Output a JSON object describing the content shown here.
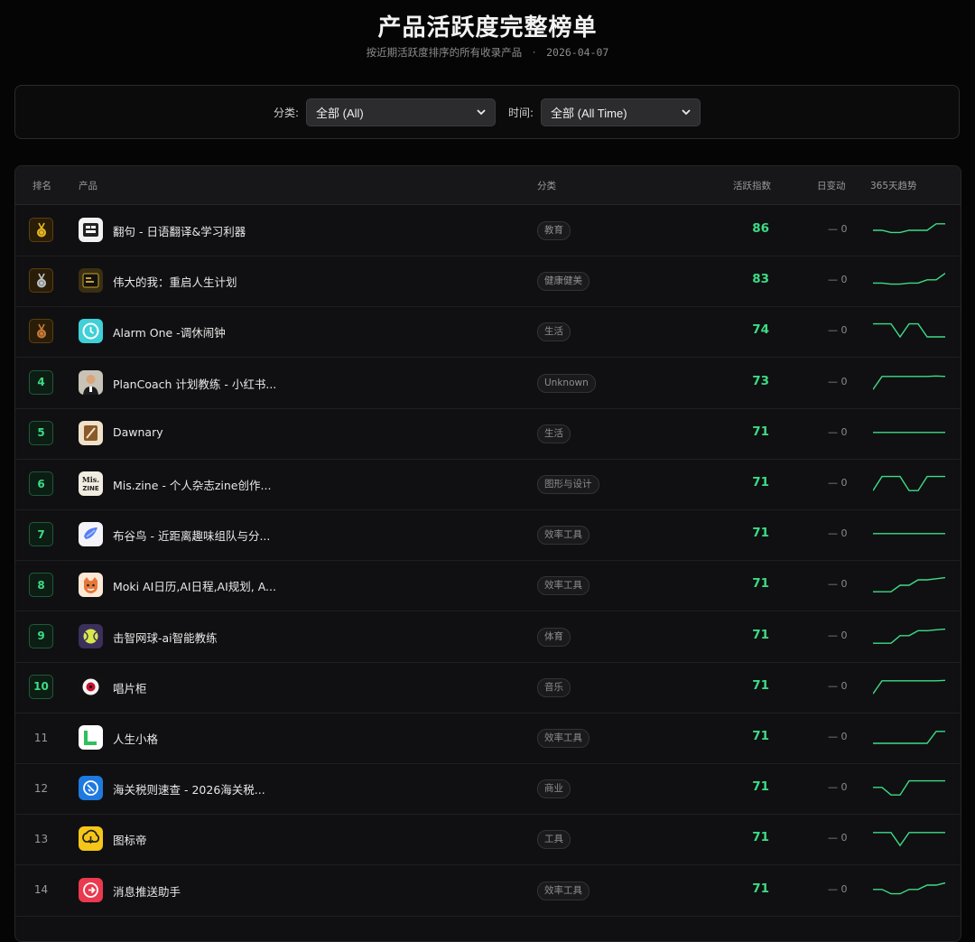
{
  "header": {
    "title": "产品活跃度完整榜单",
    "subtitle": "按近期活跃度排序的所有收录产品",
    "separator": "·",
    "date": "2026-04-07"
  },
  "filters": {
    "category_label": "分类:",
    "category_value": "全部 (All)",
    "time_label": "时间:",
    "time_value": "全部 (All Time)"
  },
  "table": {
    "columns": {
      "rank": "排名",
      "product": "产品",
      "category": "分类",
      "score": "活跃指数",
      "change": "日变动",
      "trend": "365天趋势"
    },
    "rows": [
      {
        "rank": "1",
        "name": "翻句 - 日语翻译&学习利器",
        "category": "教育",
        "score": "86",
        "change": "— 0",
        "medal": "gold",
        "icon": "fanju-icon",
        "spark": [
          50,
          50,
          40,
          40,
          50,
          50,
          50,
          80,
          80
        ]
      },
      {
        "rank": "2",
        "name": "伟大的我：重启人生计划",
        "category": "健康健美",
        "score": "83",
        "change": "— 0",
        "medal": "silver",
        "icon": "weida-icon",
        "spark": [
          40,
          40,
          35,
          35,
          40,
          40,
          55,
          55,
          85
        ]
      },
      {
        "rank": "3",
        "name": "Alarm One -调休闹钟",
        "category": "生活",
        "score": "74",
        "change": "— 0",
        "medal": "bronze",
        "icon": "alarm-icon",
        "spark": [
          85,
          85,
          85,
          25,
          85,
          85,
          25,
          25,
          25
        ]
      },
      {
        "rank": "4",
        "name": "PlanCoach 计划教练 - 小红书...",
        "category": "Unknown",
        "score": "73",
        "change": "— 0",
        "medal": "",
        "icon": "plancoach-icon",
        "spark": [
          20,
          80,
          80,
          80,
          80,
          80,
          80,
          82,
          80
        ]
      },
      {
        "rank": "5",
        "name": "Dawnary",
        "category": "生活",
        "score": "71",
        "change": "— 0",
        "medal": "",
        "icon": "dawnary-icon",
        "spark": [
          55,
          55,
          55,
          55,
          55,
          55,
          55,
          55,
          55
        ]
      },
      {
        "rank": "6",
        "name": "Mis.zine - 个人杂志zine创作...",
        "category": "图形与设计",
        "score": "71",
        "change": "— 0",
        "medal": "",
        "icon": "miszine-icon",
        "spark": [
          20,
          85,
          85,
          85,
          20,
          20,
          85,
          85,
          85
        ]
      },
      {
        "rank": "7",
        "name": "布谷鸟 - 近距离趣味组队与分...",
        "category": "效率工具",
        "score": "71",
        "change": "— 0",
        "medal": "",
        "icon": "bugu-icon",
        "spark": [
          55,
          55,
          55,
          55,
          55,
          55,
          55,
          55,
          55
        ]
      },
      {
        "rank": "8",
        "name": "Moki AI日历,AI日程,AI规划, A...",
        "category": "效率工具",
        "score": "71",
        "change": "— 0",
        "medal": "",
        "icon": "moki-icon",
        "spark": [
          20,
          20,
          20,
          50,
          50,
          75,
          75,
          80,
          85
        ]
      },
      {
        "rank": "9",
        "name": "击智网球-ai智能教练",
        "category": "体育",
        "score": "71",
        "change": "— 0",
        "medal": "",
        "icon": "tennis-icon",
        "spark": [
          20,
          20,
          20,
          55,
          55,
          78,
          78,
          82,
          85
        ]
      },
      {
        "rank": "10",
        "name": "唱片柜",
        "category": "音乐",
        "score": "71",
        "change": "— 0",
        "medal": "",
        "icon": "record-icon",
        "spark": [
          20,
          80,
          80,
          80,
          80,
          80,
          80,
          80,
          82
        ]
      },
      {
        "rank": "11",
        "name": "人生小格",
        "category": "效率工具",
        "score": "71",
        "change": "— 0",
        "medal": "",
        "icon": "rensheng-icon",
        "spark": [
          25,
          25,
          25,
          25,
          25,
          25,
          25,
          80,
          80
        ]
      },
      {
        "rank": "12",
        "name": "海关税则速查 - 2026海关税...",
        "category": "商业",
        "score": "71",
        "change": "— 0",
        "medal": "",
        "icon": "customs-icon",
        "spark": [
          55,
          55,
          20,
          20,
          85,
          85,
          85,
          85,
          85
        ]
      },
      {
        "rank": "13",
        "name": "图标帝",
        "category": "工具",
        "score": "71",
        "change": "— 0",
        "medal": "",
        "icon": "tubiao-icon",
        "spark": [
          80,
          80,
          80,
          20,
          80,
          80,
          80,
          80,
          80
        ]
      },
      {
        "rank": "14",
        "name": "消息推送助手",
        "category": "效率工具",
        "score": "71",
        "change": "— 0",
        "medal": "",
        "icon": "push-icon",
        "spark": [
          55,
          55,
          35,
          35,
          55,
          55,
          75,
          75,
          85
        ]
      }
    ]
  },
  "colors": {
    "accent": "#3ddc84",
    "background": "#050505",
    "gold": "#e8b923",
    "silver": "#bfc3c7",
    "bronze": "#c97a3a"
  }
}
